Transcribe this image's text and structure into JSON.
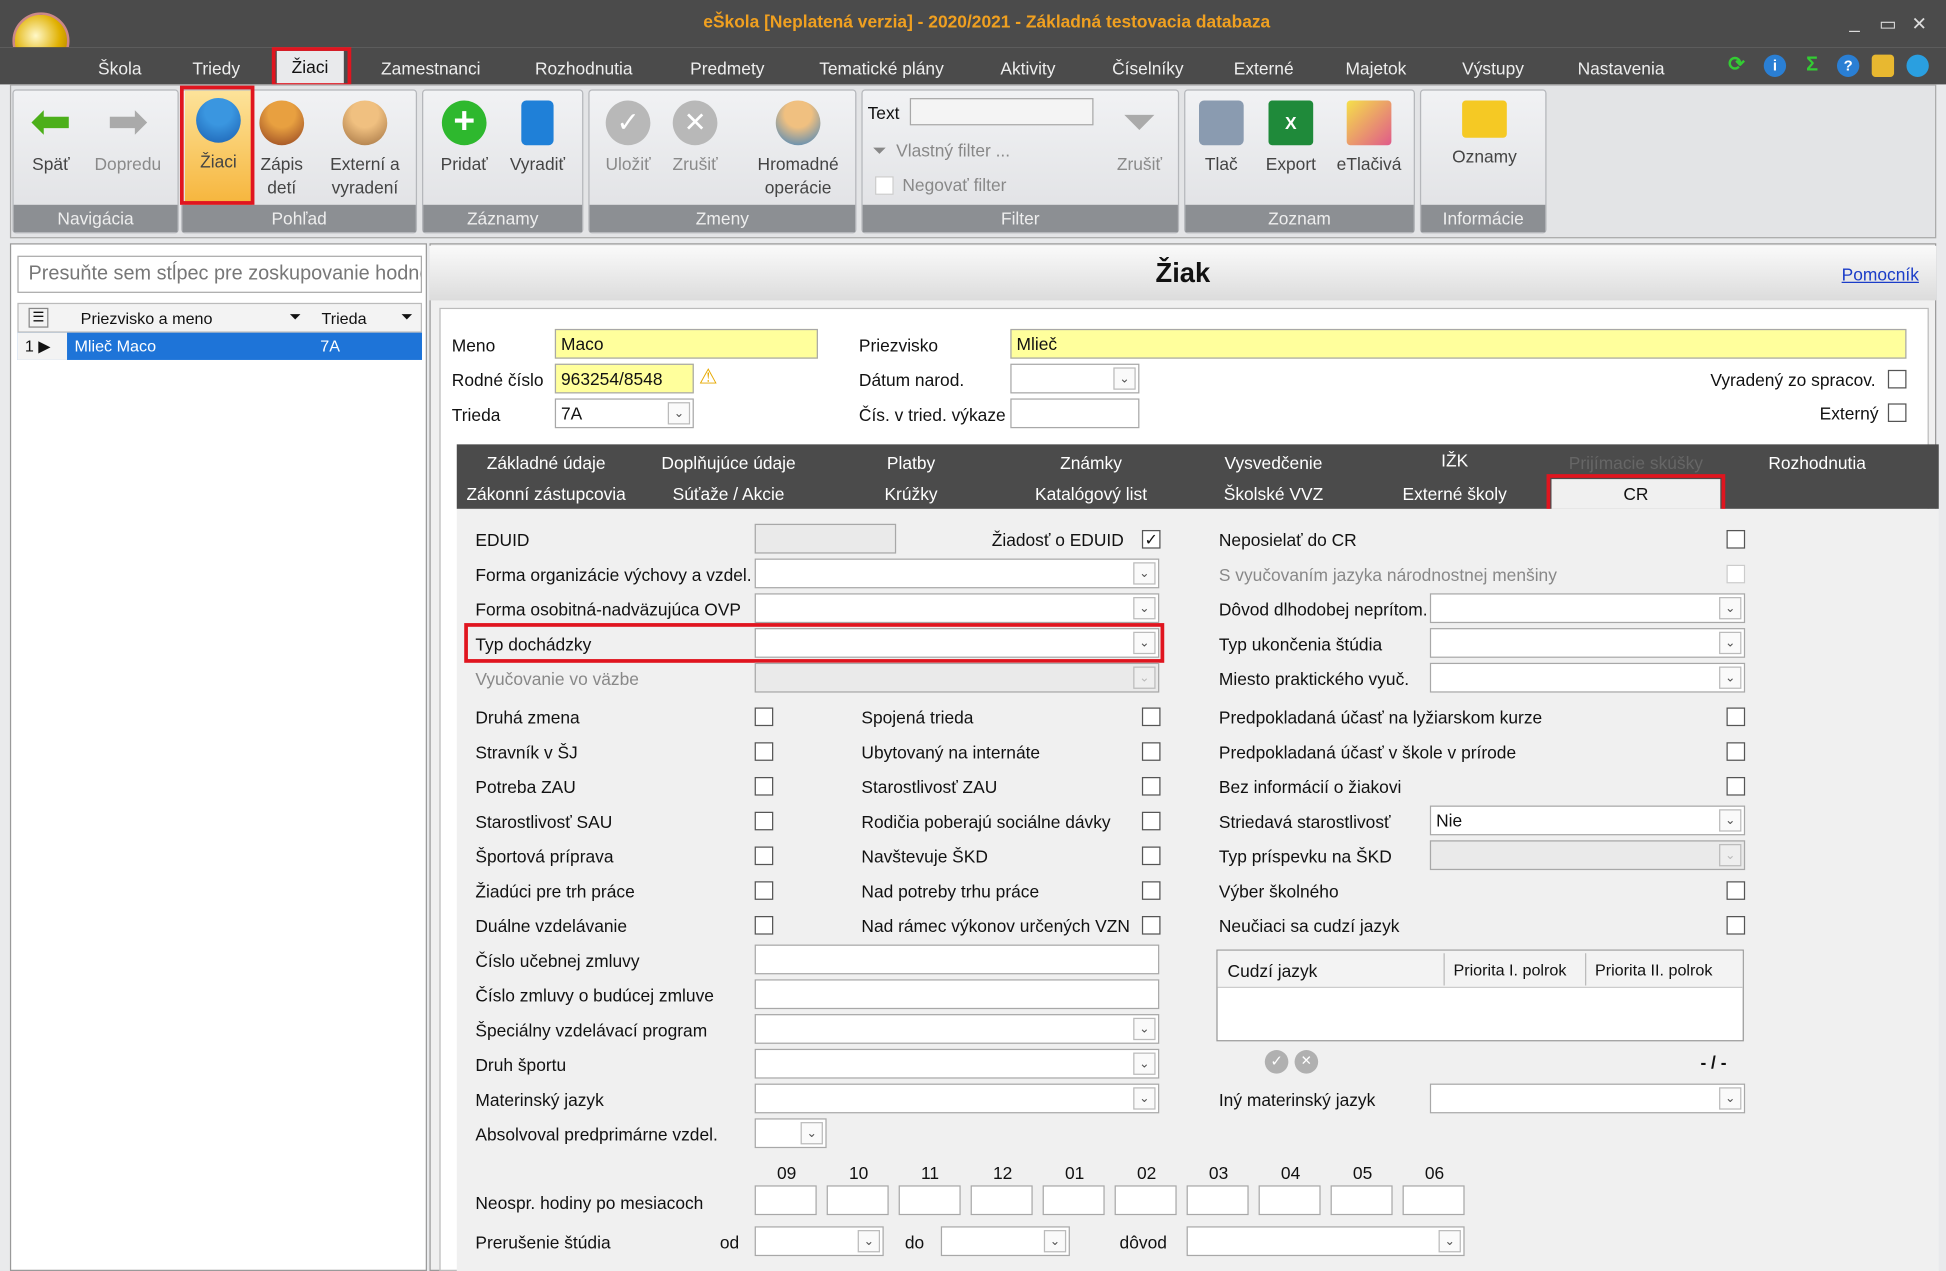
{
  "window": {
    "title": "eŠkola [Neplatená verzia] - 2020/2021 - Základná testovacia databaza",
    "min": "_",
    "max": "▭",
    "close": "✕"
  },
  "menu": [
    "Škola",
    "Triedy",
    "Žiaci",
    "Zamestnanci",
    "Rozhodnutia",
    "Predmety",
    "Tematické plány",
    "Aktivity",
    "Číselníky",
    "Externé",
    "Majetok",
    "Výstupy",
    "Nastavenia"
  ],
  "ribbon": {
    "navigacia": {
      "title": "Navigácia",
      "back": "Späť",
      "forward": "Dopredu"
    },
    "pohlad": {
      "title": "Pohľad",
      "ziaci": "Žiaci",
      "zapis1": "Zápis",
      "zapis2": "detí",
      "ext1": "Externí a",
      "ext2": "vyradení"
    },
    "zaznamy": {
      "title": "Záznamy",
      "add": "Pridať",
      "remove": "Vyradiť"
    },
    "zmeny": {
      "title": "Zmeny",
      "save": "Uložiť",
      "cancel": "Zrušiť",
      "bulk1": "Hromadné",
      "bulk2": "operácie"
    },
    "filter": {
      "title": "Filter",
      "text_label": "Text",
      "custom": "Vlastný filter ...",
      "negate": "Negovať filter",
      "cancel": "Zrušiť"
    },
    "zoznam": {
      "title": "Zoznam",
      "print": "Tlač",
      "export": "Export",
      "forms": "eTlačivá"
    },
    "informacie": {
      "title": "Informácie",
      "notices": "Oznamy"
    }
  },
  "left": {
    "group_hint": "Presuňte sem stĺpec pre zoskupovanie hodnôt",
    "col_name": "Priezvisko a meno",
    "col_class": "Trieda",
    "row": {
      "num": "1",
      "name": "Mlieč Maco",
      "class": "7A"
    }
  },
  "form": {
    "title": "Žiak",
    "help": "Pomocník",
    "meno_l": "Meno",
    "meno": "Maco",
    "priez_l": "Priezvisko",
    "priez": "Mlieč",
    "rc_l": "Rodné číslo",
    "rc": "963254/8548",
    "datum_l": "Dátum narod.",
    "vyradeny_l": "Vyradený zo spracov.",
    "trieda_l": "Trieda",
    "trieda": "7A",
    "cis_l": "Čís. v tried. výkaze",
    "externy_l": "Externý"
  },
  "tabs": {
    "row1": [
      "Základné údaje",
      "Doplňujúce údaje",
      "Platby",
      "Známky",
      "Vysvedčenie",
      "IŽK",
      "Prijímacie skúšky",
      "Rozhodnutia"
    ],
    "row2": [
      "Zákonní zástupcovia",
      "Súťaže / Akcie",
      "Krúžky",
      "Katalógový list",
      "Školské VVZ",
      "Externé školy",
      "CR"
    ]
  },
  "cr": {
    "eduid": "EDUID",
    "ziadost": "Žiadosť o EDUID",
    "neposielat": "Neposielať do CR",
    "forma_org": "Forma organizácie výchovy a vzdel.",
    "s_vyuc": "S vyučovaním jazyka národnostnej menšiny",
    "forma_osob": "Forma osobitná-nadväzujúca OVP",
    "dovod": "Dôvod dlhodobej neprítom.",
    "typ_doch": "Typ dochádzky",
    "typ_ukon": "Typ ukončenia štúdia",
    "vyuc_vazbe": "Vyučovanie vo väzbe",
    "miesto": "Miesto praktického vyuč.",
    "col1": [
      "Druhá zmena",
      "Stravník v ŠJ",
      "Potreba ZAU",
      "Starostlivosť SAU",
      "Športová príprava",
      "Žiadúci pre trh práce",
      "Duálne vzdelávanie"
    ],
    "col2": [
      "Spojená trieda",
      "Ubytovaný na internáte",
      "Starostlivosť ZAU",
      "Rodičia poberajú sociálne dávky",
      "Navštevuje ŠKD",
      "Nad potreby trhu práce",
      "Nad rámec výkonov určených VZN"
    ],
    "col3": [
      "Predpokladaná účasť na lyžiarskom kurze",
      "Predpokladaná účasť v škole v prírode",
      "Bez informácií o žiakovi"
    ],
    "striedava": "Striedavá starostlivosť",
    "striedava_val": "Nie",
    "typ_prisp": "Typ príspevku na ŠKD",
    "vyber": "Výber školného",
    "neuciaci": "Neučiaci sa cudzí jazyk",
    "lang_cols": [
      "Cudzí jazyk",
      "Priorita I. polrok",
      "Priorita II. polrok"
    ],
    "nav": "- / -",
    "cislo_uceb": "Číslo učebnej zmluvy",
    "cislo_bud": "Číslo zmluvy o budúcej zmluve",
    "spec": "Špeciálny vzdelávací program",
    "druh_sport": "Druh športu",
    "materinsky": "Materinský jazyk",
    "iny_mat": "Iný materinský jazyk",
    "absolvoval": "Absolvoval predprimárne vzdel.",
    "months": [
      "09",
      "10",
      "11",
      "12",
      "01",
      "02",
      "03",
      "04",
      "05",
      "06"
    ],
    "neospr": "Neospr. hodiny po mesiacoch",
    "prerusenie": "Prerušenie štúdia",
    "od": "od",
    "do": "do",
    "dovod2": "dôvod"
  }
}
